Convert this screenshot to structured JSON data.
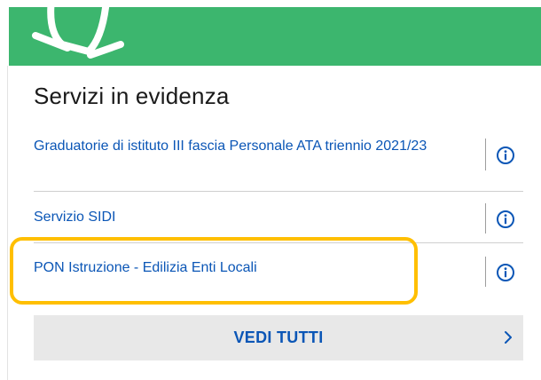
{
  "section": {
    "title": "Servizi in evidenza"
  },
  "services": [
    {
      "label": "Graduatorie di istituto III fascia Personale ATA triennio 2021/23",
      "info_icon": "info-circle-icon"
    },
    {
      "label": "Servizio SIDI",
      "info_icon": "info-circle-icon"
    },
    {
      "label": "PON Istruzione - Edilizia Enti Locali",
      "info_icon": "info-circle-icon"
    }
  ],
  "see_all": {
    "label": "VEDI TUTTI",
    "icon": "chevron-right-icon"
  },
  "colors": {
    "banner": "#3cb66e",
    "link": "#0b56b6",
    "highlight": "#ffbf00",
    "button_bg": "#e8e8e8"
  },
  "icons": {
    "banner": "bell-icon"
  }
}
